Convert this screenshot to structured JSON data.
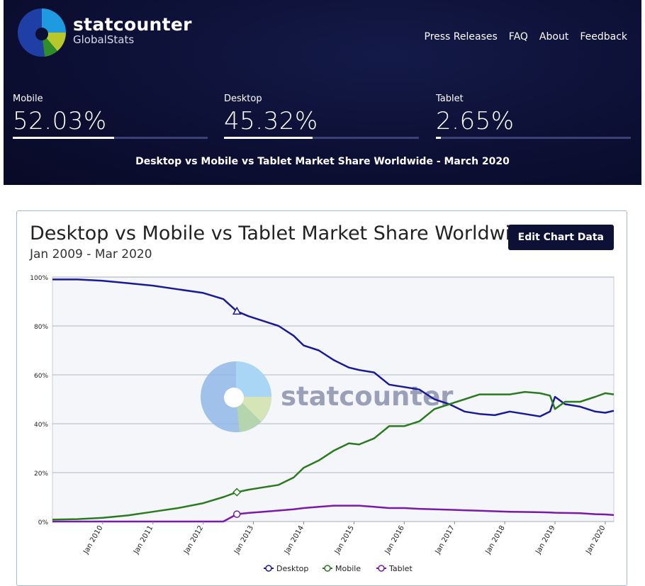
{
  "header": {
    "brand_name": "statcounter",
    "brand_sub": "GlobalStats",
    "nav": [
      "Press Releases",
      "FAQ",
      "About",
      "Feedback"
    ]
  },
  "stats": [
    {
      "label": "Mobile",
      "value": "52.03%",
      "share": 52.03
    },
    {
      "label": "Desktop",
      "value": "45.32%",
      "share": 45.32
    },
    {
      "label": "Tablet",
      "value": "2.65%",
      "share": 2.65
    }
  ],
  "hero_caption": "Desktop vs Mobile vs Tablet Market Share Worldwide - March 2020",
  "card": {
    "title": "Desktop vs Mobile vs Tablet Market Share Worldwide",
    "subtitle": "Jan 2009 - Mar 2020",
    "edit_button": "Edit Chart Data"
  },
  "watermark": "statcounter",
  "colors": {
    "desktop": "#1a1a99",
    "mobile": "#2a7a1e",
    "tablet": "#7a1aa8",
    "hero_bg": "#0c0f33"
  },
  "chart_data": {
    "type": "line",
    "title": "Desktop vs Mobile vs Tablet Market Share Worldwide",
    "subtitle": "Jan 2009 - Mar 2020",
    "xlabel": "",
    "ylabel": "",
    "ylim": [
      0,
      100
    ],
    "yticks": [
      "0%",
      "20%",
      "40%",
      "60%",
      "80%",
      "100%"
    ],
    "ytick_values": [
      0,
      20,
      40,
      60,
      80,
      100
    ],
    "xticks": [
      "Jan 2010",
      "Jan 2011",
      "Jan 2012",
      "Jan 2013",
      "Jan 2014",
      "Jan 2015",
      "Jan 2016",
      "Jan 2017",
      "Jan 2018",
      "Jan 2019",
      "Jan 2020"
    ],
    "xtick_years": [
      2010,
      2011,
      2012,
      2013,
      2014,
      2015,
      2016,
      2017,
      2018,
      2019,
      2020
    ],
    "x_range": [
      2009.0,
      2020.17
    ],
    "grid": true,
    "legend": "bottom",
    "x": [
      2009.0,
      2009.5,
      2010.0,
      2010.5,
      2011.0,
      2011.5,
      2012.0,
      2012.4,
      2012.67,
      2012.9,
      2013.2,
      2013.5,
      2013.8,
      2014.0,
      2014.3,
      2014.6,
      2014.9,
      2015.1,
      2015.4,
      2015.7,
      2016.0,
      2016.3,
      2016.6,
      2016.9,
      2017.2,
      2017.5,
      2017.8,
      2018.1,
      2018.4,
      2018.7,
      2018.9,
      2019.0,
      2019.2,
      2019.5,
      2019.8,
      2020.0,
      2020.17
    ],
    "series": [
      {
        "name": "Desktop",
        "color": "#1a1a99",
        "marker": "triangle",
        "values": [
          99,
          99,
          98.5,
          97.5,
          96.5,
          95,
          93.5,
          91,
          86,
          84,
          82,
          80,
          76,
          72,
          70,
          66,
          63,
          62,
          61,
          56,
          55,
          54,
          50,
          48,
          45,
          44,
          43.5,
          45,
          44,
          43,
          45,
          51,
          48,
          47,
          45,
          44.5,
          45.3
        ]
      },
      {
        "name": "Mobile",
        "color": "#2a7a1e",
        "marker": "diamond",
        "values": [
          0.8,
          1.0,
          1.5,
          2.5,
          4,
          5.5,
          7.5,
          10,
          12,
          13,
          14,
          15,
          18,
          22,
          25,
          29,
          32,
          31.5,
          34,
          39,
          39,
          41,
          46,
          48,
          50,
          52,
          52,
          52,
          53,
          52.5,
          51.5,
          46,
          49,
          49,
          51,
          52.5,
          52
        ]
      },
      {
        "name": "Tablet",
        "color": "#7a1aa8",
        "marker": "circle",
        "values": [
          0,
          0,
          0,
          0,
          0,
          0,
          0,
          0,
          3,
          3.5,
          4,
          4.5,
          5,
          5.5,
          6,
          6.5,
          6.5,
          6.5,
          6,
          5.5,
          5.5,
          5.2,
          5,
          4.8,
          4.6,
          4.4,
          4.2,
          4,
          3.9,
          3.8,
          3.7,
          3.6,
          3.5,
          3.4,
          3.0,
          2.9,
          2.65
        ]
      }
    ]
  }
}
